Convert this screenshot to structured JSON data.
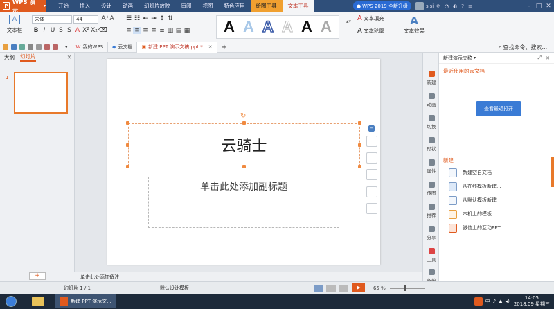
{
  "app": {
    "name": "WPS 演示",
    "logo_letter": "P"
  },
  "menu": {
    "tabs": [
      "开始",
      "插入",
      "设计",
      "动画",
      "幻灯片放映",
      "审阅",
      "视图",
      "特色应用",
      "绘图工具",
      "文本工具"
    ]
  },
  "upgrade": {
    "label": "WPS 2019 全新升级"
  },
  "user": {
    "name": "sisi"
  },
  "ribbon": {
    "textbox_label": "文本框",
    "font_name": "宋体",
    "font_size": "44",
    "text_fill": "文本填充",
    "text_outline": "文本轮廓",
    "text_effect": "文本效果",
    "style_glyph": "A"
  },
  "quickbar": {
    "tabs": [
      "我的WPS",
      "云文档",
      "新建 PPT 演示文稿.ppt *"
    ],
    "search_placeholder": "查找命令、搜索..."
  },
  "left": {
    "tab_outline": "大纲",
    "tab_slides": "幻灯片",
    "slide_number": "1"
  },
  "slide": {
    "title": "云骑士",
    "subtitle_placeholder": "单击此处添加副标题"
  },
  "notes": {
    "placeholder": "单击此处添加备注"
  },
  "right_strip": {
    "items": [
      "新建",
      "动画",
      "切换",
      "形状",
      "属性",
      "传图",
      "推荐",
      "分享",
      "工具",
      "备份"
    ]
  },
  "right_panel": {
    "title": "新建演示文稿",
    "recent_heading": "最近使用的云文档",
    "view_recent_button": "查看最近打开",
    "new_heading": "新建",
    "new_items": [
      "新建空白文档",
      "从在线模板新建...",
      "从默认模板新建",
      "本机上的模板...",
      "微信上的互动PPT"
    ]
  },
  "status": {
    "slide_info": "幻灯片 1 / 1",
    "template": "默认设计模板",
    "zoom": "65 %"
  },
  "taskbar": {
    "task_label": "新建 PPT 演示文...",
    "time": "14:05",
    "date": "2018.09 星期三",
    "ime": "中"
  },
  "colors": {
    "title_bar": "#2f4f7a",
    "accent_orange": "#e05a1e",
    "selection": "#f08a40",
    "button_blue": "#2a6bd4"
  }
}
